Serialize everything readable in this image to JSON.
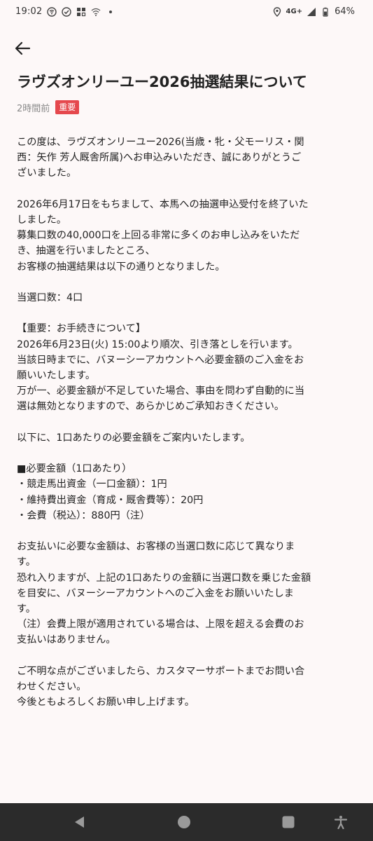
{
  "status_bar": {
    "time": "19:02",
    "network": "4G+",
    "battery": "64%"
  },
  "article": {
    "title": "ラヴズオンリーユー2026抽選結果について",
    "time_ago": "2時間前",
    "badge": "重要",
    "paragraphs": [
      [
        "この度は、ラヴズオンリーユー2026(当歳・牝・父モーリス・関",
        "西：矢作 芳人厩舎所属)へお申込みいただき、誠にありがとうご",
        "ざいました。"
      ],
      [
        "2026年6月17日をもちまして、本馬への抽選申込受付を終了いた",
        "しました。",
        "募集口数の40,000口を上回る非常に多くのお申し込みをいただ",
        "き、抽選を行いましたところ、",
        "お客様の抽選結果は以下の通りとなりました。"
      ],
      [
        "当選口数：4口"
      ],
      [
        "【重要：お手続きについて】",
        "2026年6月23日(火) 15:00より順次、引き落としを行います。",
        "当該日時までに、バヌーシーアカウントへ必要金額のご入金をお",
        "願いいたします。",
        "万が一、必要金額が不足していた場合、事由を問わず自動的に当",
        "選は無効となりますので、あらかじめご承知おきください。"
      ],
      [
        "以下に、1口あたりの必要金額をご案内いたします。"
      ],
      [
        "■必要金額（1口あたり）",
        "・競走馬出資金（一口金額）：1円",
        "・維持費出資金（育成・厩舎費等）：20円",
        "・会費（税込）：880円（注）"
      ],
      [
        "お支払いに必要な金額は、お客様の当選口数に応じて異なりま",
        "す。",
        "恐れ入りますが、上記の1口あたりの金額に当選口数を乗じた金額",
        "を目安に、バヌーシーアカウントへのご入金をお願いいたしま",
        "す。",
        "（注）会費上限が適用されている場合は、上限を超える会費のお",
        "支払いはありません。"
      ],
      [
        "ご不明な点がございましたら、カスタマーサポートまでお問い合",
        "わせください。",
        "今後ともよろしくお願い申し上げます。"
      ]
    ]
  },
  "icons": {
    "back": "back-arrow-icon",
    "nav_back": "triangle-back-icon",
    "nav_home": "circle-home-icon",
    "nav_recents": "square-recents-icon",
    "nav_accessibility": "accessibility-icon"
  },
  "colors": {
    "background": "#fdf8f8",
    "badge": "#e5484d",
    "nav_bar": "#2b2b2b"
  }
}
